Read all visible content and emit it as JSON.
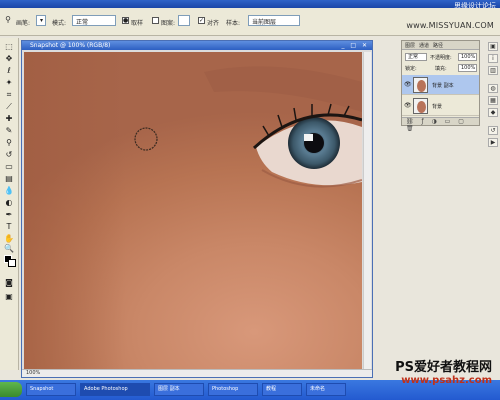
{
  "app": {
    "title": "Adobe Photoshop"
  },
  "watermarks": {
    "top": "思缘设计论坛",
    "site": "www.MISSYUAN.COM",
    "bottom_line1": "PS爱好者教程网",
    "bottom_line2": "www.psahz.com"
  },
  "options_bar": {
    "brush_label": "画笔:",
    "mode_label": "模式:",
    "mode_value": "正常",
    "source_sampled": "取样",
    "source_pattern": "图案:",
    "aligned_label": "对齐",
    "sample_label": "样本:",
    "sample_value": "当前图层"
  },
  "document": {
    "title": "Snapshot  @ 100% (RGB/8)",
    "zoom": "100%"
  },
  "layers_panel": {
    "tabs": [
      "图层",
      "通道",
      "路径"
    ],
    "blend_mode": "正常",
    "opacity_label": "不透明度:",
    "opacity": "100%",
    "lock_label": "锁定:",
    "fill_label": "填充:",
    "fill": "100%",
    "layers": [
      {
        "name": "背景 副本",
        "selected": true
      },
      {
        "name": "背景",
        "selected": false
      }
    ]
  },
  "taskbar": {
    "tasks": [
      "Snapshot",
      "Adobe Photoshop",
      "图层 副本",
      "Photoshop",
      "教程",
      "未命名"
    ]
  },
  "colors": {
    "accent": "#2d5fc2",
    "skin": "#c98767",
    "selection": "#aec7ee"
  }
}
